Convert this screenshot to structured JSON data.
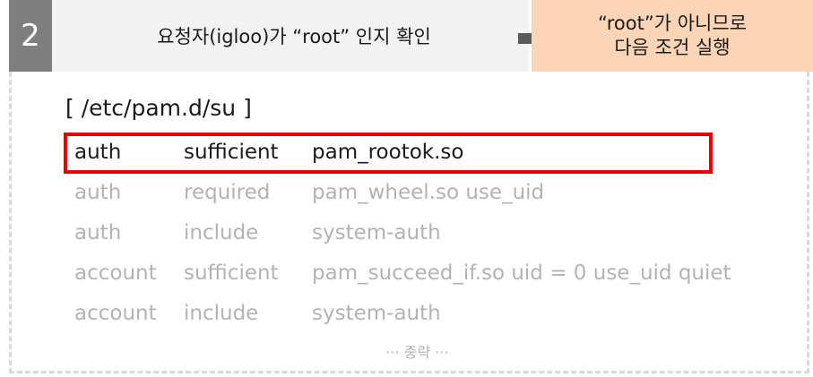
{
  "step": {
    "number": "2",
    "title": "요청자(igloo)가 “root” 인지 확인"
  },
  "result": {
    "line1": "“root”가 아니므로",
    "line2": "다음 조건 실행"
  },
  "config": {
    "file_path": "[ /etc/pam.d/su ]",
    "lines": [
      {
        "type": "auth",
        "control": "sufficient",
        "module": "pam_rootok.so",
        "highlighted": true
      },
      {
        "type": "auth",
        "control": "required",
        "module": "pam_wheel.so use_uid",
        "highlighted": false
      },
      {
        "type": "auth",
        "control": "include",
        "module": "system-auth",
        "highlighted": false
      },
      {
        "type": "account",
        "control": "sufficient",
        "module": "pam_succeed_if.so uid = 0 use_uid quiet",
        "highlighted": false
      },
      {
        "type": "account",
        "control": "include",
        "module": "system-auth",
        "highlighted": false
      }
    ],
    "omitted_note": "··· 중략 ···"
  },
  "colors": {
    "badge": "#7f7f7f",
    "title_bar": "#f2f2f2",
    "result_box": "#fbd5b5",
    "highlight": "#e60000",
    "dimmed_text": "#b3b3b3",
    "arrow": "#595959"
  },
  "icons": {
    "arrow": "right-arrow-icon"
  }
}
